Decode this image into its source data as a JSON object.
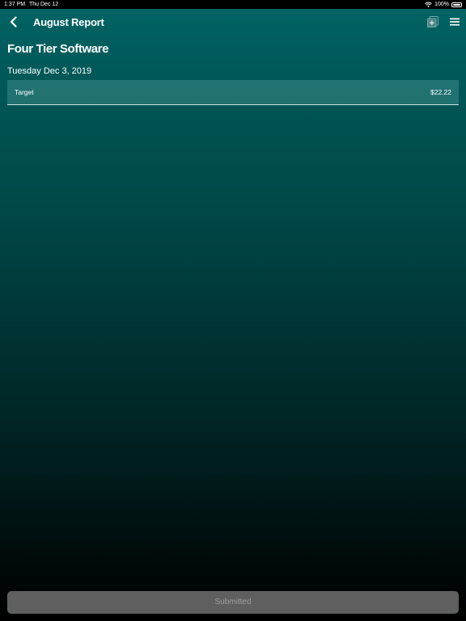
{
  "status_bar": {
    "time": "1:37 PM",
    "date": "Thu Dec 12",
    "battery_text": "100%",
    "wifi_icon": "wifi-icon",
    "battery_icon": "battery-icon"
  },
  "nav": {
    "back_icon": "chevron-left-icon",
    "title": "August Report",
    "add_icon": "add-receipt-icon",
    "menu_icon": "hamburger-menu-icon"
  },
  "report": {
    "company": "Four Tier Software",
    "date": "Tuesday Dec 3, 2019",
    "expenses": [
      {
        "merchant": "Target",
        "amount": "$22.22"
      }
    ]
  },
  "footer": {
    "submit_label": "Submitted"
  },
  "colors": {
    "background_top": "#006565",
    "background_bottom": "#000000",
    "row_background": "#2f6f6f",
    "button_background": "#5f5f5f",
    "button_text": "#9e9e9e"
  }
}
